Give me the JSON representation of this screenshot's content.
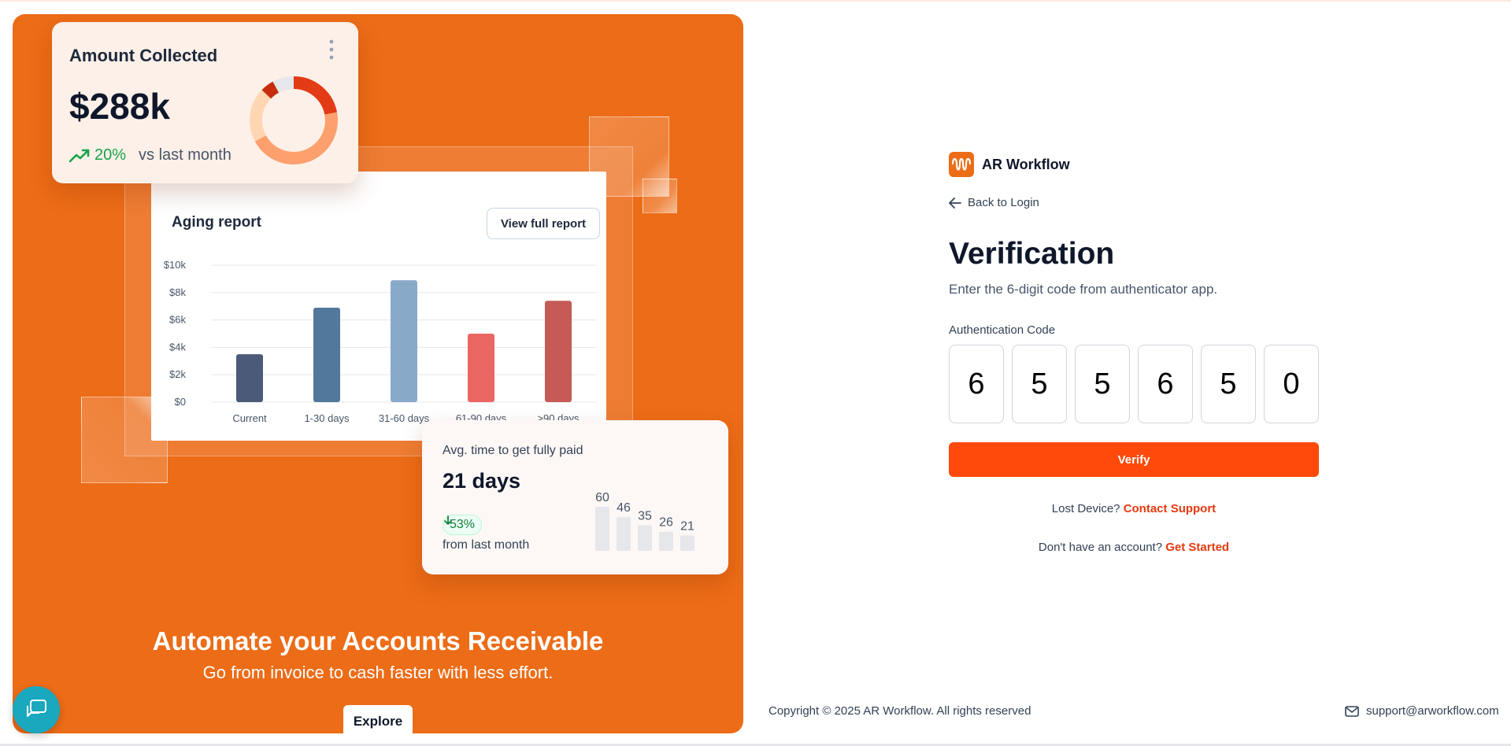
{
  "left": {
    "collected_card": {
      "title": "Amount Collected",
      "value": "$288k",
      "growth": "20%",
      "growth_note": "vs last month"
    },
    "aging_card": {
      "title": "Aging report",
      "button": "View full report"
    },
    "avg_card": {
      "title": "Avg. time to get fully paid",
      "value": "21 days",
      "change": "53%",
      "change_note": "from last month"
    },
    "headline": "Automate your Accounts Receivable",
    "subheadline": "Go from invoice to cash faster with less effort.",
    "explore_label": "Explore"
  },
  "chart_data": [
    {
      "type": "bar",
      "title": "Aging report",
      "categories": [
        "Current",
        "1-30 days",
        "31-60 days",
        "61-90 days",
        ">90 days"
      ],
      "values": [
        3500,
        6900,
        8900,
        5000,
        7400
      ],
      "colors": [
        "#4b5a78",
        "#52789b",
        "#89a9c9",
        "#e96662",
        "#c55a56"
      ],
      "yticks": [
        "$0",
        "$2k",
        "$4k",
        "$6k",
        "$8k",
        "$10k"
      ],
      "ylim": [
        0,
        10000
      ],
      "grid": true
    },
    {
      "type": "pie",
      "title": "Amount Collected",
      "values": [
        22,
        45,
        20,
        5,
        8
      ],
      "colors": [
        "#e23b16",
        "#fda06d",
        "#fed7b2",
        "#c62d0f",
        "#e5e7eb"
      ]
    },
    {
      "type": "bar",
      "title": "Avg. time to get fully paid",
      "values": [
        60,
        46,
        35,
        26,
        21
      ],
      "data_labels": [
        "60",
        "46",
        "35",
        "26",
        "21"
      ],
      "colors": [
        "#e5e7eb"
      ]
    }
  ],
  "auth": {
    "brand": "AR Workflow",
    "back_label": "Back to Login",
    "title": "Verification",
    "subtitle": "Enter the 6-digit code from authenticator app.",
    "code_label": "Authentication Code",
    "digits": [
      "6",
      "5",
      "5",
      "6",
      "5",
      "0"
    ],
    "verify_label": "Verify",
    "lost_text": "Lost Device?",
    "lost_link": "Contact Support",
    "account_text": "Don't have an account?",
    "account_link": "Get Started"
  },
  "footer": {
    "copyright": "Copyright © 2025 AR Workflow. All rights reserved",
    "email": "support@arworkflow.com"
  },
  "colors": {
    "hero": "#ec6c17",
    "accent": "#ff4a0b",
    "link": "#e5390e",
    "chat": "#1aa8bf"
  }
}
